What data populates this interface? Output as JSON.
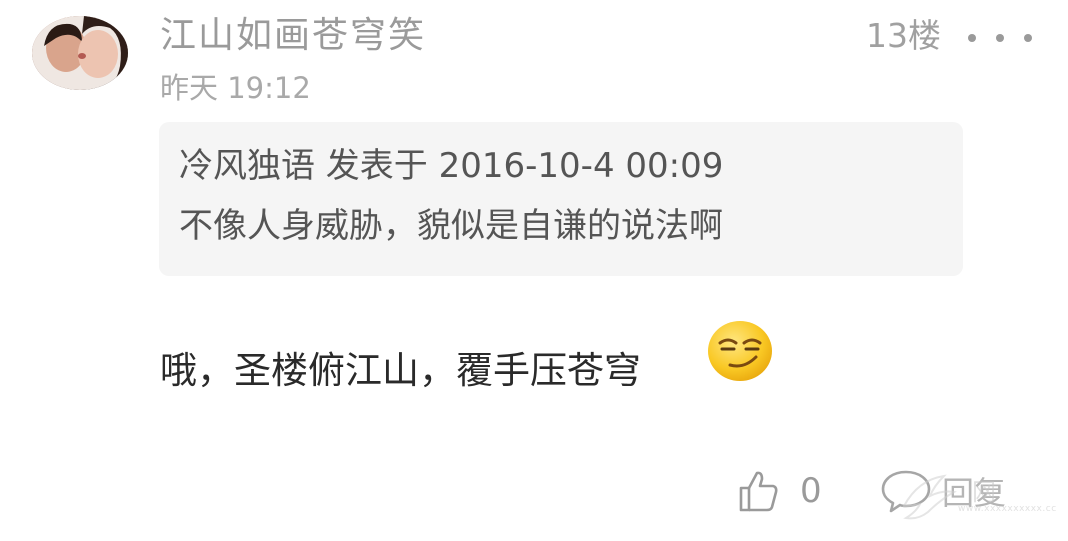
{
  "post": {
    "username": "江山如画苍穹笑",
    "time": "昨天 19:12",
    "floor": "13楼",
    "more_icon": "more-dots-icon"
  },
  "quote": {
    "meta": "冷风独语 发表于 2016-10-4 00:09",
    "text": "不像人身威胁，貌似是自谦的说法啊"
  },
  "reply": {
    "text": "哦，圣楼俯江山，覆手压苍穹",
    "emoji": "smirk-emoji"
  },
  "actions": {
    "like_icon": "thumbs-up-icon",
    "like_count": "0",
    "reply_icon": "comment-bubble-icon",
    "reply_label": "回复"
  },
  "watermark": {
    "text": "网",
    "subtext": "www.xxxxxxxxxx.cc"
  }
}
